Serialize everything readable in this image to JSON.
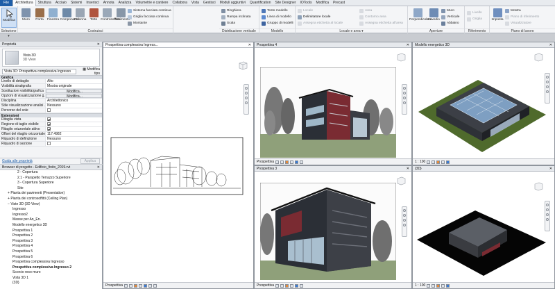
{
  "tabs": [
    "File",
    "Architettura",
    "Struttura",
    "Acciaio",
    "Sistemi",
    "Inserisci",
    "Annota",
    "Analizza",
    "Volumetrie e cantiere",
    "Collabora",
    "Vista",
    "Gestisci",
    "Moduli aggiuntivi",
    "Quantification",
    "Site Designer",
    "IOTools",
    "Modifica",
    "Precast"
  ],
  "active_tab": "Architettura",
  "ribbon": {
    "modify": {
      "label": "Modifica",
      "group": "Selezione ▾"
    },
    "build": {
      "group": "Costruisci",
      "buttons": [
        "Muro",
        "Porta",
        "Finestra",
        "Componente",
        "Colonna",
        "Tetto",
        "Controsoffitto",
        "Pavimento"
      ]
    },
    "curtain": {
      "items": [
        "Sistema facciata continua",
        "Griglia facciata continua",
        "Montante"
      ]
    },
    "circulation": {
      "group": "Distribuzione verticale",
      "items": [
        "Ringhiera",
        "Rampa inclinata",
        "Scala"
      ]
    },
    "model": {
      "group": "Modello",
      "items": [
        "Testo modello",
        "Linea di modello",
        "Gruppo di modelli"
      ]
    },
    "room": {
      "group": "Locale e area ▾",
      "items": [
        "Locale",
        "Separatore locali",
        "Delimitatore locale",
        "Assegna etichetta al locale",
        "Area",
        "Contorno area",
        "Assegna etichetta all'area"
      ]
    },
    "opening": {
      "group": "Aperture",
      "items": [
        "Perpendicolare",
        "Cavedio",
        "Muro",
        "Verticale",
        "Abbaino"
      ]
    },
    "datum": {
      "group": "Riferimento",
      "items": [
        "Livello",
        "Griglia"
      ]
    },
    "workplane": {
      "group": "Piano di lavoro",
      "items": [
        "Imposta",
        "Mostra",
        "Piano di riferimento",
        "Visualizzatore"
      ]
    }
  },
  "properties": {
    "title": "Proprietà",
    "type_name": "Vista 3D",
    "type_sub": "3D View",
    "instance": "Vista 3D: Prospettiva complessiva Ingresso",
    "edit_type": "Modifica tipo",
    "sections": [
      {
        "name": "Grafica",
        "rows": [
          {
            "k": "Livello di dettaglio",
            "v": "Alto"
          },
          {
            "k": "Visibilità stratigrafia",
            "v": "Mostra originale"
          },
          {
            "k": "Sostituzioni visibilità/grafica",
            "v": "Modifica...",
            "btn": true
          },
          {
            "k": "Opzioni di visualizzazione g...",
            "v": "Modifica...",
            "btn": true
          },
          {
            "k": "Disciplina",
            "v": "Architettonico"
          },
          {
            "k": "Stile visualizzazione analisi ...",
            "v": "Nessuno"
          },
          {
            "k": "Percorso del sole",
            "v": "",
            "chk": false
          }
        ]
      },
      {
        "name": "Estensioni",
        "rows": [
          {
            "k": "Ritaglia vista",
            "v": "",
            "chk": true
          },
          {
            "k": "Regione di taglio visibile",
            "v": "",
            "chk": true
          },
          {
            "k": "Ritaglio orizzontale attivo",
            "v": "",
            "chk": true
          },
          {
            "k": "Offset del ritaglio orizzontale",
            "v": "117.4982"
          },
          {
            "k": "Riquadro di definizione",
            "v": "Nessuno"
          },
          {
            "k": "Riquadro di sezione",
            "v": "",
            "chk": false
          }
        ]
      }
    ],
    "help_link": "Guida alle proprietà",
    "apply": "Applica"
  },
  "browser": {
    "title": "Browser di progetto - Edificio_finito_2019.rvt",
    "items": [
      {
        "t": "2 - Copertura",
        "d": 3
      },
      {
        "t": "2.1 - Parapetto Terrazzo Superiore",
        "d": 3
      },
      {
        "t": "3 - Copertura Superiore",
        "d": 3
      },
      {
        "t": "Site",
        "d": 3
      },
      {
        "t": "Pianta dei pavimenti (Presentation)",
        "d": 1,
        "e": "+"
      },
      {
        "t": "Pianta dei controsoffitti (Ceiling Plan)",
        "d": 1,
        "e": "+"
      },
      {
        "t": "Viste 3D (3D View)",
        "d": 1,
        "e": "−"
      },
      {
        "t": "Ingresso",
        "d": 2
      },
      {
        "t": "Ingresso2",
        "d": 2
      },
      {
        "t": "Masse per An_En.",
        "d": 2
      },
      {
        "t": "Modello energetico 3D",
        "d": 2
      },
      {
        "t": "Prospettiva 1",
        "d": 2
      },
      {
        "t": "Prospettiva 2",
        "d": 2
      },
      {
        "t": "Prospettiva 3",
        "d": 2
      },
      {
        "t": "Prospettiva 4",
        "d": 2
      },
      {
        "t": "Prospettiva 5",
        "d": 2
      },
      {
        "t": "Prospettiva 6",
        "d": 2
      },
      {
        "t": "Prospettiva complessiva Ingresso",
        "d": 2
      },
      {
        "t": "Prospettiva complessiva Ingresso 2",
        "d": 2,
        "b": true
      },
      {
        "t": "Scorcio reso muro",
        "d": 2
      },
      {
        "t": "Vista 3D 1",
        "d": 2
      },
      {
        "t": "{3D}",
        "d": 2
      }
    ]
  },
  "views": {
    "v1": {
      "tab": "Prospettiva complessiva Ingress...",
      "bar": "Prospettiva"
    },
    "v2": {
      "tab": "Prospettiva 4",
      "bar": "Prospettiva"
    },
    "v3": {
      "tab": "Modello energetico 3D",
      "bar": "1 : 100"
    },
    "v4": {
      "tab": "Prospettiva 3",
      "bar": "Prospettiva"
    },
    "v5": {
      "tab": "{3D}",
      "bar": "1 : 100"
    }
  },
  "colors": {
    "file_tab": "#1f5ea8",
    "accent": "#3a7bd5"
  }
}
